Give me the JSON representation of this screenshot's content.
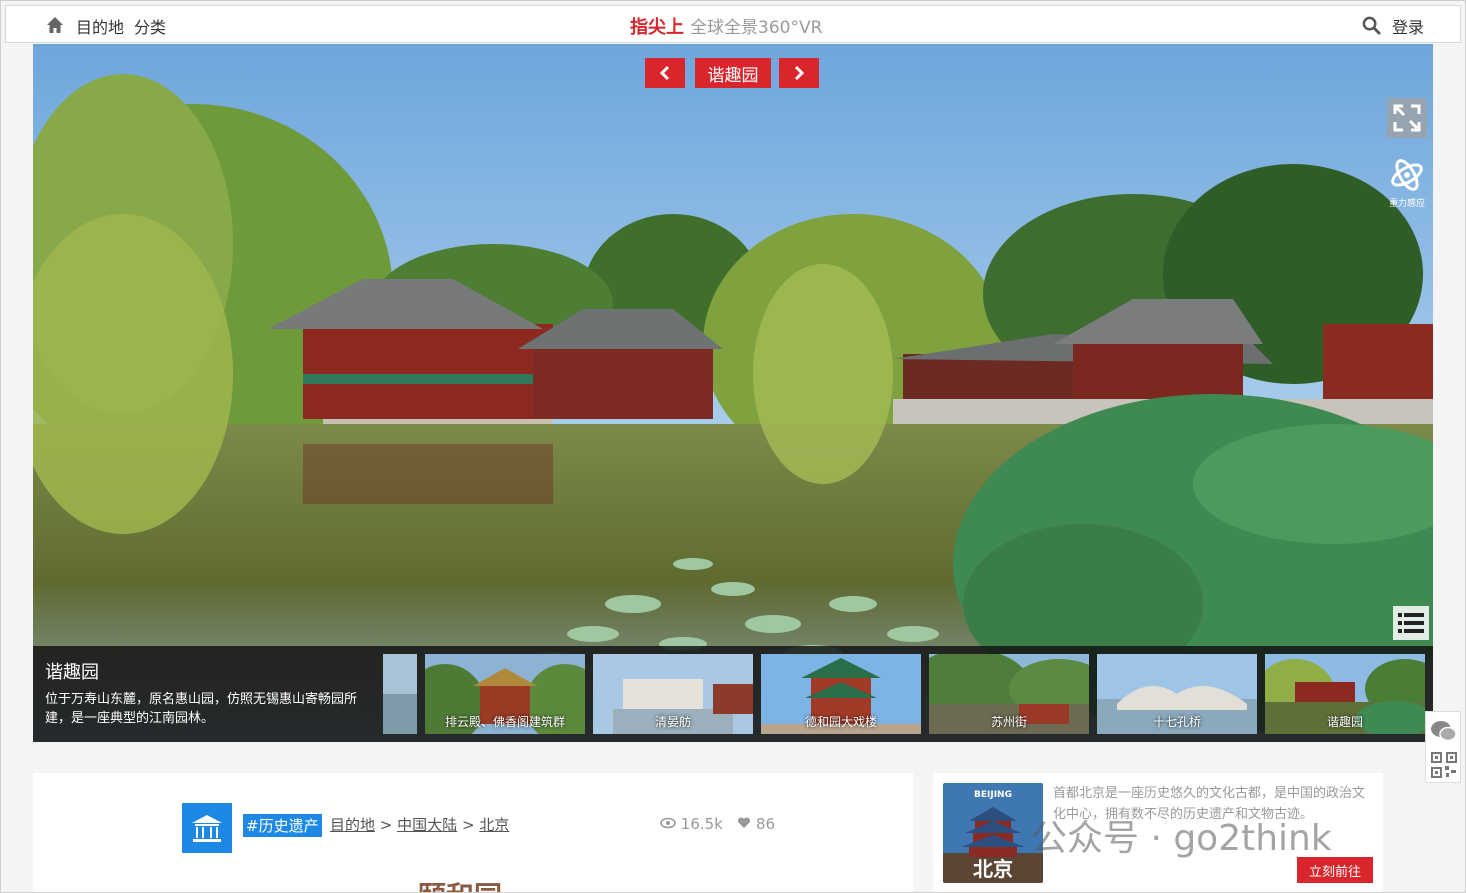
{
  "topbar": {
    "icon_home": "home-icon",
    "nav_destination": "目的地",
    "nav_category": "分类",
    "brand_name": "指尖上",
    "brand_tagline": "全球全景360°VR",
    "icon_search": "search-icon",
    "login": "登录"
  },
  "scene": {
    "title": "谐趣园",
    "prev_icon": "chevron-left-icon",
    "next_icon": "chevron-right-icon",
    "fullscreen_icon": "fullscreen-icon",
    "gyro_label": "重力感应",
    "list_icon": "list-icon"
  },
  "info": {
    "title": "谐趣园",
    "description": "位于万寿山东麓，原名惠山园，仿照无锡惠山寄畅园所建，是一座典型的江南园林。"
  },
  "thumbnails": [
    {
      "label": "",
      "active": false
    },
    {
      "label": "排云殿、佛香阁建筑群",
      "active": false
    },
    {
      "label": "清晏舫",
      "active": false
    },
    {
      "label": "德和园大戏楼",
      "active": false
    },
    {
      "label": "苏州街",
      "active": false
    },
    {
      "label": "十七孔桥",
      "active": false
    },
    {
      "label": "谐趣园",
      "active": true
    }
  ],
  "content": {
    "tag": "#历史遗产",
    "crumb_1": "目的地",
    "crumb_2": "中国大陆",
    "crumb_3": "北京",
    "sep": ">",
    "views": "16.5k",
    "likes": "86",
    "title": "颐和园"
  },
  "city": {
    "image_top_text": "BEIJING",
    "image_name": "北京",
    "description": "首都北京是一座历史悠久的文化古都，是中国的政治文化中心，拥有数不尽的历史遗产和文物古迹。",
    "go_button": "立刻前往"
  },
  "watermark": "公众号 · go2think",
  "colors": {
    "accent": "#d9262c",
    "blue": "#1e88e5"
  }
}
